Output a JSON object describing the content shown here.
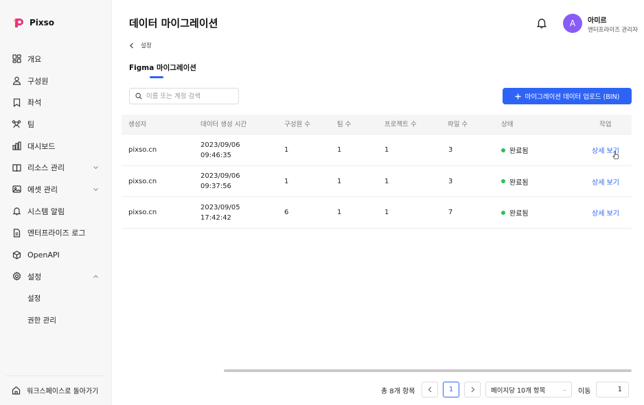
{
  "app": {
    "logo_text": "Pixso"
  },
  "sidebar": {
    "items": [
      {
        "label": "개요",
        "icon": "overview-icon"
      },
      {
        "label": "구성원",
        "icon": "user-icon"
      },
      {
        "label": "좌석",
        "icon": "bookmark-icon"
      },
      {
        "label": "팀",
        "icon": "team-icon"
      },
      {
        "label": "대시보드",
        "icon": "dashboard-icon"
      },
      {
        "label": "리소스 관리",
        "icon": "book-icon"
      },
      {
        "label": "에셋 관리",
        "icon": "asset-icon"
      },
      {
        "label": "시스템 알림",
        "icon": "bell-icon"
      },
      {
        "label": "엔터프라이즈 로그",
        "icon": "log-icon"
      },
      {
        "label": "OpenAPI",
        "icon": "cube-icon"
      },
      {
        "label": "설정",
        "icon": "gear-icon"
      }
    ],
    "sub_items": [
      {
        "label": "설정"
      },
      {
        "label": "권한 관리"
      }
    ],
    "back_label": "워크스페이스로 돌아가기"
  },
  "header": {
    "title": "데이터 마이그레이션",
    "user_initial": "A",
    "user_name": "아미르",
    "user_role": "엔터프라이즈 관리자"
  },
  "breadcrumb": {
    "label": "설정"
  },
  "tabs": [
    {
      "label": "Figma 마이그레이션"
    }
  ],
  "search": {
    "placeholder": "이름 또는 계정 검색"
  },
  "upload_button": {
    "label": "마이그레이션 데이터 업로드 (BIN)"
  },
  "table": {
    "columns": [
      "생성자",
      "데이터 생성 시간",
      "구성원 수",
      "팀 수",
      "프로젝트 수",
      "파일 수",
      "상태",
      "작업"
    ],
    "rows": [
      {
        "creator": "pixso.cn",
        "date": "2023/09/06",
        "time": "09:46:35",
        "members": "1",
        "teams": "1",
        "projects": "1",
        "files": "3",
        "status": "완료됨",
        "action": "상세 보기"
      },
      {
        "creator": "pixso.cn",
        "date": "2023/09/06",
        "time": "09:37:56",
        "members": "1",
        "teams": "1",
        "projects": "1",
        "files": "3",
        "status": "완료됨",
        "action": "상세 보기"
      },
      {
        "creator": "pixso.cn",
        "date": "2023/09/05",
        "time": "17:42:42",
        "members": "6",
        "teams": "1",
        "projects": "1",
        "files": "7",
        "status": "완료됨",
        "action": "상세 보기"
      }
    ],
    "status_color": "#2dbf58"
  },
  "pagination": {
    "total": "총 8개 항목",
    "current_page": "1",
    "page_size": "페이지당 10개 항목",
    "goto_label": "이동",
    "goto_value": "1"
  },
  "colors": {
    "accent": "#2e64f6",
    "avatar": "#8a5cf6"
  }
}
